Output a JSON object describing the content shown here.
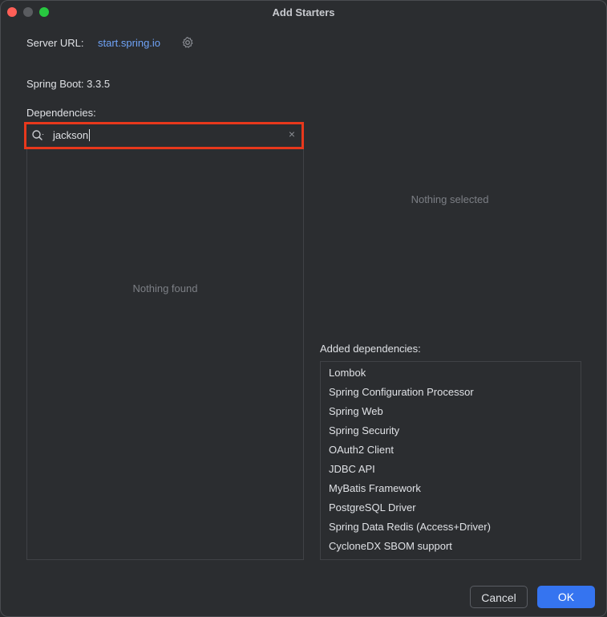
{
  "window": {
    "title": "Add Starters"
  },
  "server": {
    "label": "Server URL:",
    "url": "start.spring.io"
  },
  "spring_boot": {
    "label": "Spring Boot:",
    "version": "3.3.5"
  },
  "dependencies": {
    "label": "Dependencies:",
    "search_value": "jackson",
    "results_empty": "Nothing found"
  },
  "details": {
    "empty": "Nothing selected"
  },
  "added": {
    "label": "Added dependencies:",
    "items": [
      "Lombok",
      "Spring Configuration Processor",
      "Spring Web",
      "Spring Security",
      "OAuth2 Client",
      "JDBC API",
      "MyBatis Framework",
      "PostgreSQL Driver",
      "Spring Data Redis (Access+Driver)",
      "CycloneDX SBOM support"
    ]
  },
  "buttons": {
    "cancel": "Cancel",
    "ok": "OK"
  },
  "colors": {
    "accent": "#3574f0",
    "highlight": "#e8381c",
    "link": "#6fa3f7"
  },
  "icons": [
    "gear-icon",
    "search-icon",
    "clear-icon"
  ]
}
